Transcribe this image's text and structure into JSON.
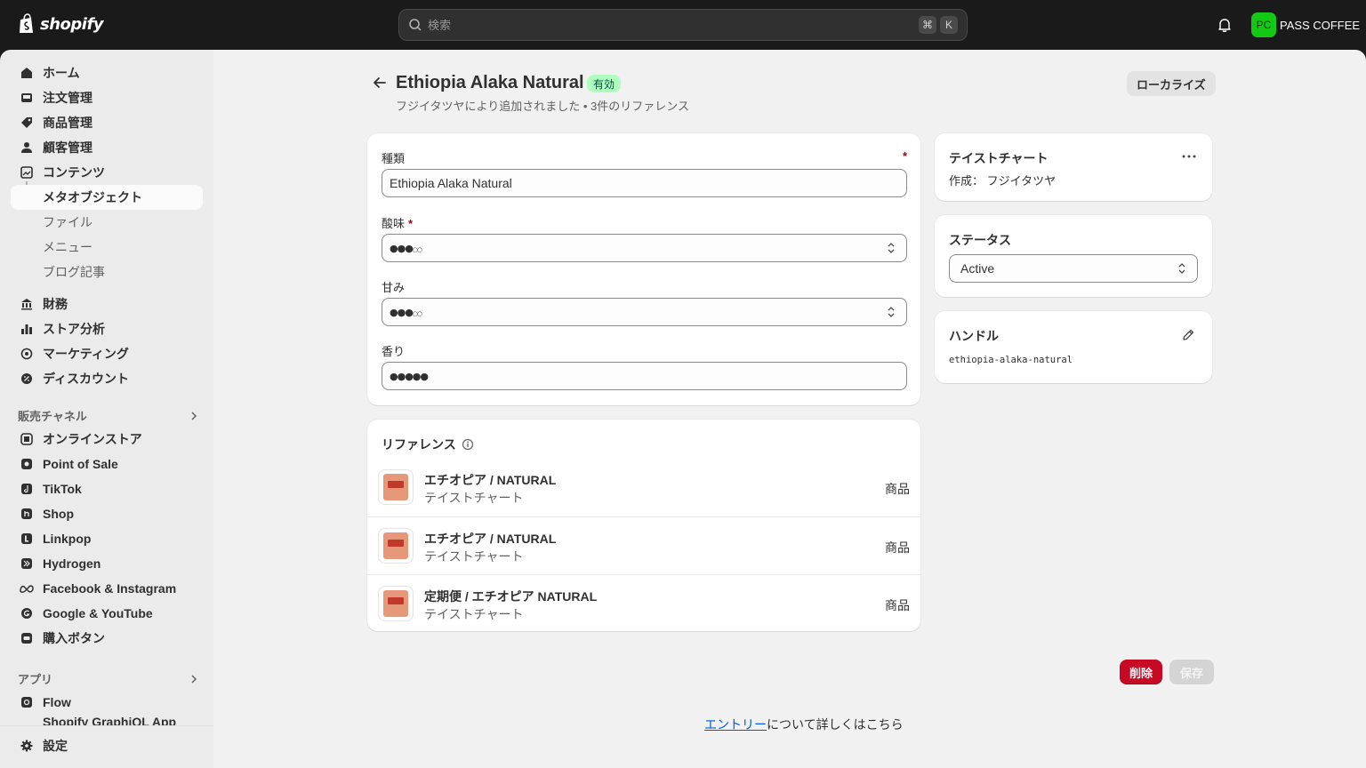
{
  "topbar": {
    "brand": "shopify",
    "search_placeholder": "検索",
    "shortcut_cmd": "⌘",
    "shortcut_key": "K",
    "account_initials": "PC",
    "account_name": "PASS COFFEE"
  },
  "sidebar": {
    "items": [
      {
        "label": "ホーム",
        "icon": "home-icon"
      },
      {
        "label": "注文管理",
        "icon": "inbox-icon"
      },
      {
        "label": "商品管理",
        "icon": "tag-icon"
      },
      {
        "label": "顧客管理",
        "icon": "person-icon"
      },
      {
        "label": "コンテンツ",
        "icon": "image-icon"
      }
    ],
    "active_sub": "メタオブジェクト",
    "sub_items": [
      "ファイル",
      "メニュー",
      "ブログ記事"
    ],
    "items2": [
      {
        "label": "財務",
        "icon": "bank-icon"
      },
      {
        "label": "ストア分析",
        "icon": "bar-chart-icon"
      },
      {
        "label": "マーケティング",
        "icon": "target-icon"
      },
      {
        "label": "ディスカウント",
        "icon": "discount-icon"
      }
    ],
    "sales_channels_title": "販売チャネル",
    "channels": [
      {
        "label": "オンラインストア",
        "icon": "online-store-icon"
      },
      {
        "label": "Point of Sale",
        "icon": "pos-icon"
      },
      {
        "label": "TikTok",
        "icon": "tiktok-icon"
      },
      {
        "label": "Shop",
        "icon": "shop-icon"
      },
      {
        "label": "Linkpop",
        "icon": "linkpop-icon"
      },
      {
        "label": "Hydrogen",
        "icon": "hydrogen-icon"
      },
      {
        "label": "Facebook & Instagram",
        "icon": "meta-icon"
      },
      {
        "label": "Google & YouTube",
        "icon": "google-icon"
      },
      {
        "label": "購入ボタン",
        "icon": "buy-button-icon"
      }
    ],
    "apps_title": "アプリ",
    "apps": [
      {
        "label": "Flow",
        "icon": "flow-icon"
      },
      {
        "label": "Shopify GraphiQL App",
        "icon": "graphiql-icon"
      }
    ],
    "settings_label": "設定"
  },
  "header": {
    "title": "Ethiopia Alaka Natural",
    "status_badge": "有効",
    "subtitle": "フジイタツヤにより追加されました • 3件のリファレンス",
    "localize_label": "ローカライズ"
  },
  "fields": {
    "type_label": "種類",
    "type_value": "Ethiopia Alaka Natural",
    "acidity_label": "酸味",
    "acidity_rating": 3,
    "sweetness_label": "甘み",
    "sweetness_rating": 3,
    "aroma_label": "香り",
    "aroma_rating": 5,
    "max_rating": 5
  },
  "references": {
    "title": "リファレンス",
    "rows": [
      {
        "title": "エチオピア / NATURAL",
        "subtitle": "テイストチャート",
        "type": "商品"
      },
      {
        "title": "エチオピア / NATURAL",
        "subtitle": "テイストチャート",
        "type": "商品"
      },
      {
        "title": "定期便 / エチオピア NATURAL",
        "subtitle": "テイストチャート",
        "type": "商品"
      }
    ]
  },
  "definition_card": {
    "title": "テイストチャート",
    "creator_prefix": "作成：",
    "creator": "フジイタツヤ"
  },
  "status_card": {
    "title": "ステータス",
    "value": "Active"
  },
  "handle_card": {
    "title": "ハンドル",
    "value": "ethiopia-alaka-natural"
  },
  "actions": {
    "delete_label": "削除",
    "save_label": "保存"
  },
  "footer": {
    "link_text": "エントリー",
    "suffix": "について詳しくはこちら"
  },
  "colors": {
    "accent_green": "#14c914",
    "badge_bg": "#affebf",
    "danger": "#c70a24",
    "link": "#005bd3"
  }
}
